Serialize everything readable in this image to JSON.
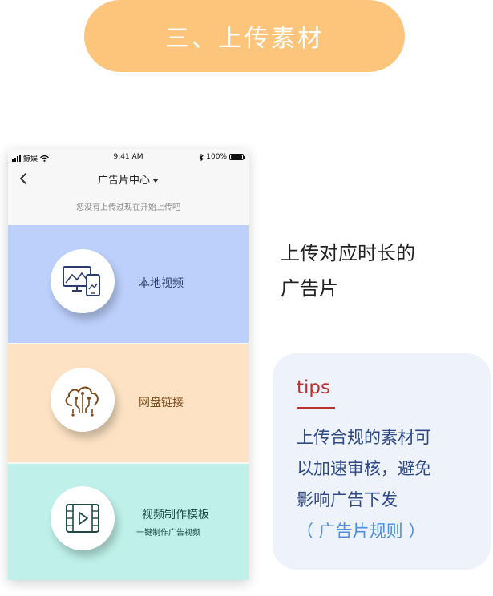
{
  "header": {
    "step_title": "三、上传素材"
  },
  "phone": {
    "status": {
      "carrier": "鲸娱",
      "time": "9:41 AM",
      "battery": "100%"
    },
    "nav": {
      "title": "广告片中心"
    },
    "hint": "您没有上传过现在开始上传吧",
    "options": [
      {
        "label": "本地视频",
        "icon": "monitor-phone-icon",
        "bg": "#bcd0fb"
      },
      {
        "label": "网盘链接",
        "icon": "cloud-link-icon",
        "bg": "#fde3c3"
      },
      {
        "label": "视频制作模板",
        "sub": "一键制作广告视频",
        "icon": "film-play-icon",
        "bg": "#bff0ea"
      }
    ]
  },
  "description": {
    "line1": "上传对应时长的",
    "line2": "广告片"
  },
  "tips": {
    "title": "tips",
    "line1": "上传合规的素材可",
    "line2": "以加速审核，避免",
    "line3": "影响广告下发",
    "link": "（ 广告片规则 ）"
  },
  "colors": {
    "accent_orange": "#fcc57b",
    "tips_red": "#b8312f",
    "tips_blue": "#2e4a86",
    "link_blue": "#4a8fe0"
  }
}
